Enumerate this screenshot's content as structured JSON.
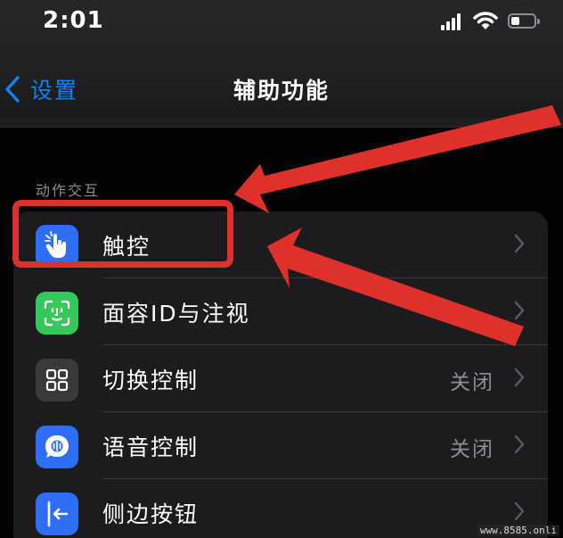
{
  "status_bar": {
    "time": "2:01"
  },
  "nav": {
    "back_label": "设置",
    "title": "辅助功能"
  },
  "section": {
    "header": "动作交互"
  },
  "rows": [
    {
      "label": "触控",
      "value": "",
      "icon": "touch-hand-icon",
      "color": "#2d6ef5"
    },
    {
      "label": "面容ID与注视",
      "value": "",
      "icon": "face-id-icon",
      "color": "#34c759"
    },
    {
      "label": "切换控制",
      "value": "关闭",
      "icon": "switch-control-icon",
      "color": "#3a3a3c"
    },
    {
      "label": "语音控制",
      "value": "关闭",
      "icon": "voice-control-icon",
      "color": "#2d6ef5"
    },
    {
      "label": "侧边按钮",
      "value": "",
      "icon": "side-button-icon",
      "color": "#2d6ef5"
    }
  ],
  "annotation": {
    "color": "#e0302b"
  },
  "watermark": "www.8585.onli"
}
